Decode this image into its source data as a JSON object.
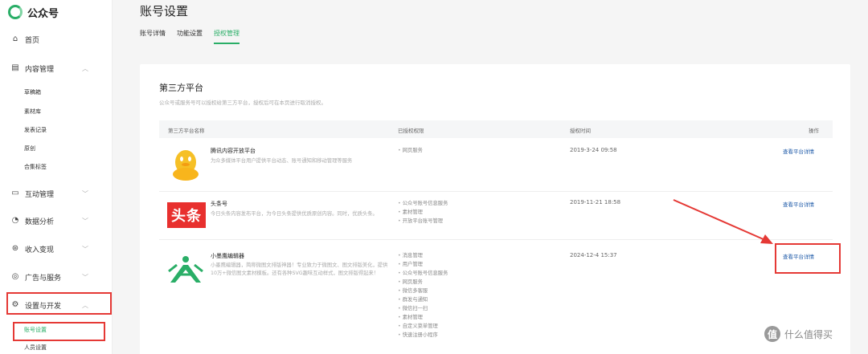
{
  "brand": {
    "name": "公众号",
    "accent": "#2aae67"
  },
  "sidebar": {
    "items": [
      {
        "label": "首页",
        "icon": "home-icon"
      },
      {
        "label": "内容管理",
        "icon": "document-icon"
      },
      {
        "label": "互动管理",
        "icon": "chat-icon"
      },
      {
        "label": "数据分析",
        "icon": "chart-icon"
      },
      {
        "label": "收入变现",
        "icon": "money-icon"
      },
      {
        "label": "广告与服务",
        "icon": "compass-icon"
      },
      {
        "label": "设置与开发",
        "icon": "gear-icon"
      }
    ],
    "content_sub": [
      "草稿箱",
      "素材库",
      "发表记录",
      "原创",
      "合集标签"
    ],
    "settings_sub": [
      "账号设置",
      "人员设置"
    ]
  },
  "page": {
    "title": "账号设置",
    "tabs": [
      "账号详情",
      "功能设置",
      "授权管理"
    ],
    "active_tab": "授权管理"
  },
  "section": {
    "title": "第三方平台",
    "desc": "公众号或服务号可以授权给第三方平台，授权后可在本页进行取消授权。"
  },
  "table": {
    "headers": {
      "name": "第三方平台名称",
      "perms": "已授权权限",
      "time": "授权时间",
      "op": "操作"
    },
    "rows": [
      {
        "name": "腾讯内容开放平台",
        "desc": "为众多媒体平台用户提供平台动态、账号通知和移动管理等服务",
        "perms": [
          "网页服务"
        ],
        "time": "2019-3-24 09:58",
        "op": "查看平台详情"
      },
      {
        "name": "头条号",
        "desc": "今日头条内容发布平台，为今日头条提供优质原创内容。同时，优质头条。",
        "logo_text": "头条",
        "perms": [
          "公众号账号信息服务",
          "素材管理",
          "开放平台账号管理"
        ],
        "time": "2019-11-21 18:58",
        "op": "查看平台详情"
      },
      {
        "name": "小墨鹰编辑器",
        "desc": "小墨鹰编辑器，简称微图文排版神器！专业致力于微图文、图文排版美化，提供10万+微信图文素材模板。还有各种SVG趣味互动样式，图文排版得起来！",
        "perms": [
          "消息管理",
          "用户管理",
          "公众号账号信息服务",
          "网页服务",
          "微信多客服",
          "群发与通知",
          "微信扫一扫",
          "素材管理",
          "自定义菜单管理",
          "快速注册小程序"
        ],
        "time": "2024-12-4 15:37",
        "op": "查看平台详情"
      }
    ]
  },
  "watermark": {
    "text": "什么值得买",
    "mark": "值"
  }
}
